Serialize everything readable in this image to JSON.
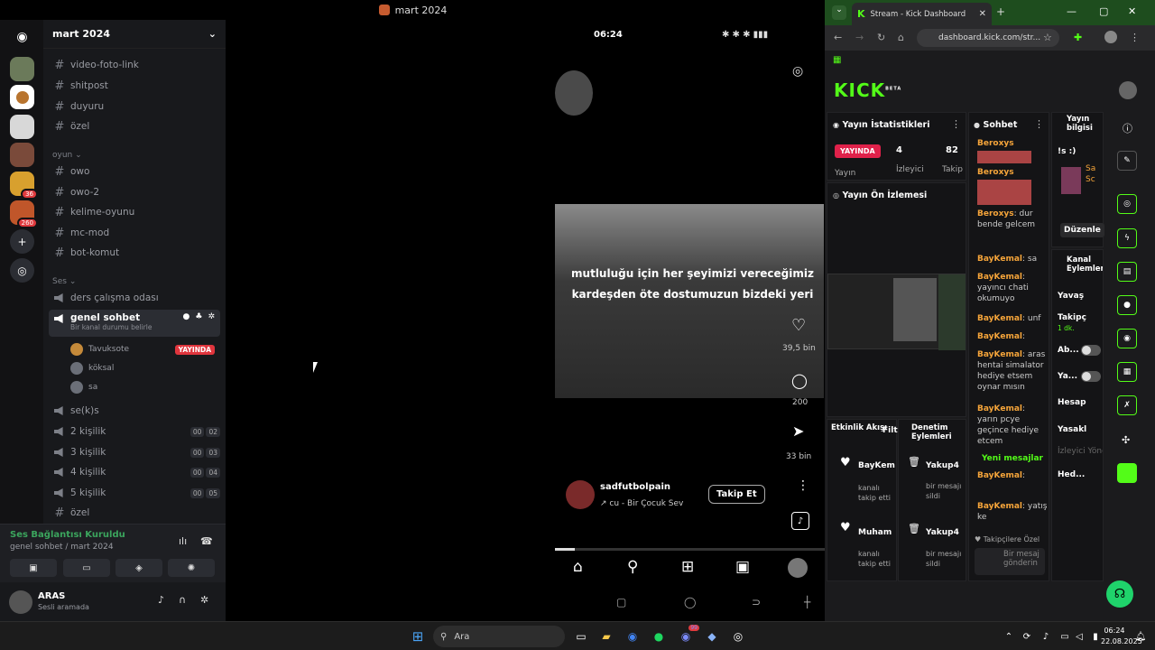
{
  "topbar": {
    "title": "mart 2024"
  },
  "discord": {
    "server_name": "mart 2024",
    "badges": {
      "b1": "36",
      "b2": "260"
    },
    "channels": [
      {
        "label": "video-foto-link",
        "type": "text"
      },
      {
        "label": "shitpost",
        "type": "text"
      },
      {
        "label": "duyuru",
        "type": "text"
      },
      {
        "label": "özel",
        "type": "text"
      }
    ],
    "cat_oyun": "oyun",
    "oyun_channels": [
      {
        "label": "owo"
      },
      {
        "label": "owo-2"
      },
      {
        "label": "kelime-oyunu"
      },
      {
        "label": "mc-mod"
      },
      {
        "label": "bot-komut"
      }
    ],
    "cat_ses": "Ses",
    "voice1": "ders çalışma odası",
    "voice_sel": "genel sohbet",
    "voice_sel_sub": "Bir kanal durumu belirle",
    "voice_users": [
      {
        "name": "Tavuksote",
        "live": "YAYINDA"
      },
      {
        "name": "köksal"
      },
      {
        "name": "sa"
      }
    ],
    "voice_more": [
      {
        "label": "se(k)s"
      },
      {
        "label": "2 kişilik",
        "a": "00",
        "b": "02"
      },
      {
        "label": "3 kişilik",
        "a": "00",
        "b": "03"
      },
      {
        "label": "4 kişilik",
        "a": "00",
        "b": "04"
      },
      {
        "label": "5 kişilik",
        "a": "00",
        "b": "05"
      },
      {
        "label": "özel"
      }
    ],
    "conn_status": "Ses Bağlantısı Kuruldu",
    "conn_sub": "genel sohbet / mart 2024",
    "user_name": "ARAS",
    "user_status": "Sesli aramada"
  },
  "phone": {
    "time": "06:24",
    "overlay_text": "mutluluğu için her şeyimizi vereceğimiz kardeşden öte dostumuzun bizdeki yeri",
    "likes": "39,5 bin",
    "comments": "200",
    "shares": "33 bin",
    "account": "sadfutbolpain",
    "song": "↗ cu - Bir Çocuk Sev",
    "follow_label": "Takip Et"
  },
  "kick": {
    "tab_title": "Stream - Kick Dashboard",
    "url": "dashboard.kick.com/str...",
    "logo": "KICK",
    "logo_sup": "BETA",
    "stats_title": "Yayın İstatistikleri",
    "live_label": "YAYINDA",
    "stat_viewers": "4",
    "stat_viewers_label": "İzleyici",
    "stat_followers": "82",
    "stat_followers_label": "Takip",
    "stat_stream_label": "Yayın",
    "preview_title": "Yayın Ön İzlemesi",
    "activity_title": "Etkinlik Akışı",
    "activity_filter": "Filt",
    "mod_title": "Denetim Eylemleri",
    "activity": [
      {
        "name": "BayKem",
        "text": "kanalı takip etti"
      },
      {
        "name": "Muham",
        "text": "kanalı takip etti"
      }
    ],
    "mod": [
      {
        "name": "Yakup4",
        "text": "bir mesajı sildi"
      },
      {
        "name": "Yakup4",
        "text": "bir mesajı sildi"
      }
    ],
    "chat_title": "Sohbet",
    "chat": [
      {
        "user": "Beroxys",
        "text": ""
      },
      {
        "user": "Beroxys",
        "text": ""
      },
      {
        "user": "Beroxys",
        "text": ": dur bende gelcem"
      },
      {
        "user": "BayKemal",
        "text": ": sa"
      },
      {
        "user": "BayKemal",
        "text": ": yayıncı chati okumuyo"
      },
      {
        "user": "BayKemal",
        "text": ": unf"
      },
      {
        "user": "BayKemal",
        "text": ":"
      },
      {
        "user": "BayKemal",
        "text": ": aras hentai simalator hediye etsem oynar mısın"
      },
      {
        "user": "BayKemal",
        "text": ": yarın pcye geçince hediye etcem"
      }
    ],
    "new_messages": "Yeni mesajlar",
    "chat_after": [
      {
        "user": "BayKemal",
        "text": ":"
      },
      {
        "user": "BayKemal",
        "text": ": yatış ke"
      }
    ],
    "followers_only": "Takipçilere Özel",
    "send_placeholder": "Bir mesaj gönderin",
    "info_title": "Yayın bilgisi",
    "info_text": "!s :)",
    "info_cat": "Sa Sc",
    "edit_label": "Düzenle",
    "channel_actions": "Kanal Eylemleri",
    "actions": [
      {
        "label": "Yavaş"
      },
      {
        "label": "Takipç",
        "sub": "1 dk."
      },
      {
        "label": "Ab..."
      },
      {
        "label": "Ya..."
      },
      {
        "label": "Hesap"
      },
      {
        "label": "Yasakl"
      },
      {
        "label": "İzleyici Yöne"
      },
      {
        "label": "Hed..."
      }
    ]
  },
  "taskbar": {
    "search": "Ara",
    "time": "06:24",
    "date": "22.08.2025",
    "badge": "99"
  }
}
